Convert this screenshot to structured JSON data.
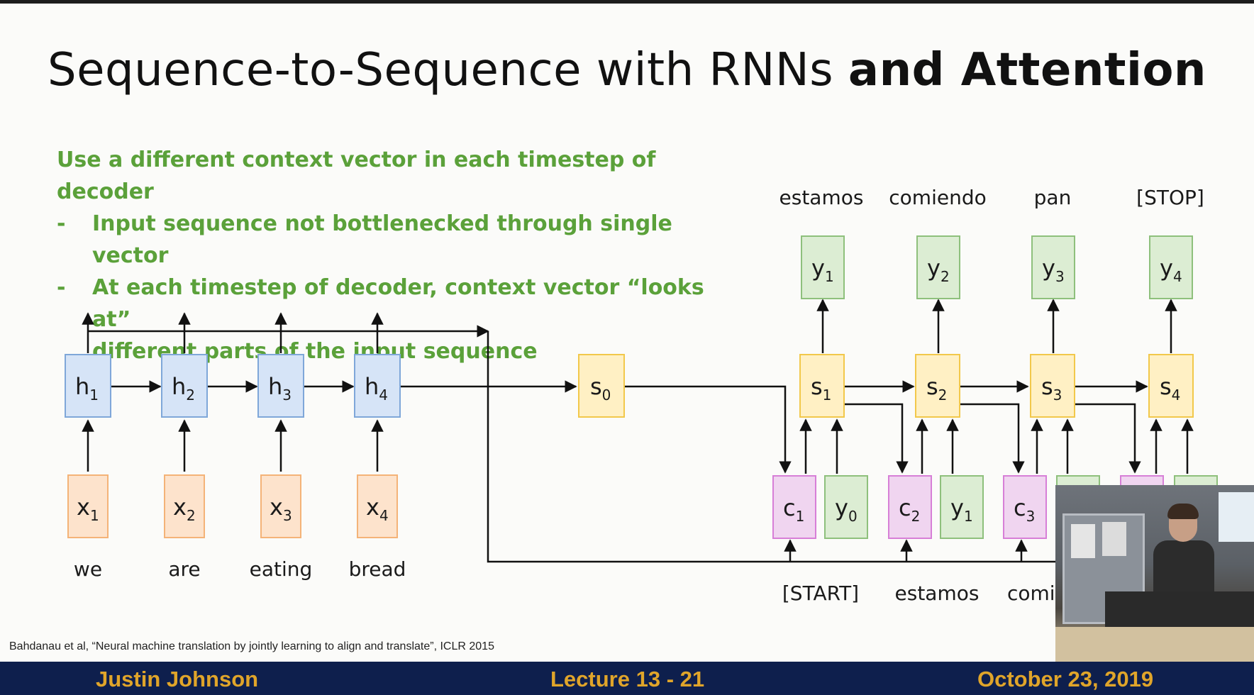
{
  "slide": {
    "title_regular": "Sequence-to-Sequence with RNNs",
    "title_bold": "and Attention",
    "bullets": {
      "lead": "Use a different context vector in each timestep of decoder",
      "dash": "-",
      "item1": "Input sequence not bottlenecked through single vector",
      "item2_line1": "At each timestep of decoder, context vector “looks at”",
      "item2_line2": "different parts of the input sequence"
    },
    "citation": "Bahdanau et al, “Neural machine translation by jointly learning to align and translate”, ICLR 2015"
  },
  "diagram": {
    "encoder_hidden": [
      {
        "main": "h",
        "sub": "1"
      },
      {
        "main": "h",
        "sub": "2"
      },
      {
        "main": "h",
        "sub": "3"
      },
      {
        "main": "h",
        "sub": "4"
      }
    ],
    "encoder_inputs": [
      {
        "main": "x",
        "sub": "1"
      },
      {
        "main": "x",
        "sub": "2"
      },
      {
        "main": "x",
        "sub": "3"
      },
      {
        "main": "x",
        "sub": "4"
      }
    ],
    "input_words": [
      "we",
      "are",
      "eating",
      "bread"
    ],
    "initial_state": {
      "main": "s",
      "sub": "0"
    },
    "decoder_states": [
      {
        "main": "s",
        "sub": "1"
      },
      {
        "main": "s",
        "sub": "2"
      },
      {
        "main": "s",
        "sub": "3"
      },
      {
        "main": "s",
        "sub": "4"
      }
    ],
    "decoder_outputs": [
      {
        "main": "y",
        "sub": "1"
      },
      {
        "main": "y",
        "sub": "2"
      },
      {
        "main": "y",
        "sub": "3"
      },
      {
        "main": "y",
        "sub": "4"
      }
    ],
    "output_words": [
      "estamos",
      "comiendo",
      "pan",
      "[STOP]"
    ],
    "context_vectors": [
      {
        "main": "c",
        "sub": "1"
      },
      {
        "main": "c",
        "sub": "2"
      },
      {
        "main": "c",
        "sub": "3"
      }
    ],
    "decoder_inputs": [
      {
        "main": "y",
        "sub": "0"
      },
      {
        "main": "y",
        "sub": "1"
      }
    ],
    "decoder_input_words": [
      "[START]",
      "estamos",
      "comi"
    ]
  },
  "footer": {
    "author": "Justin Johnson",
    "lecture": "Lecture 13 - 21",
    "date": "October 23, 2019"
  },
  "colors": {
    "bullet_green": "#5ba13a",
    "footer_bg": "#0e1f4d",
    "footer_text": "#e0a52a"
  }
}
